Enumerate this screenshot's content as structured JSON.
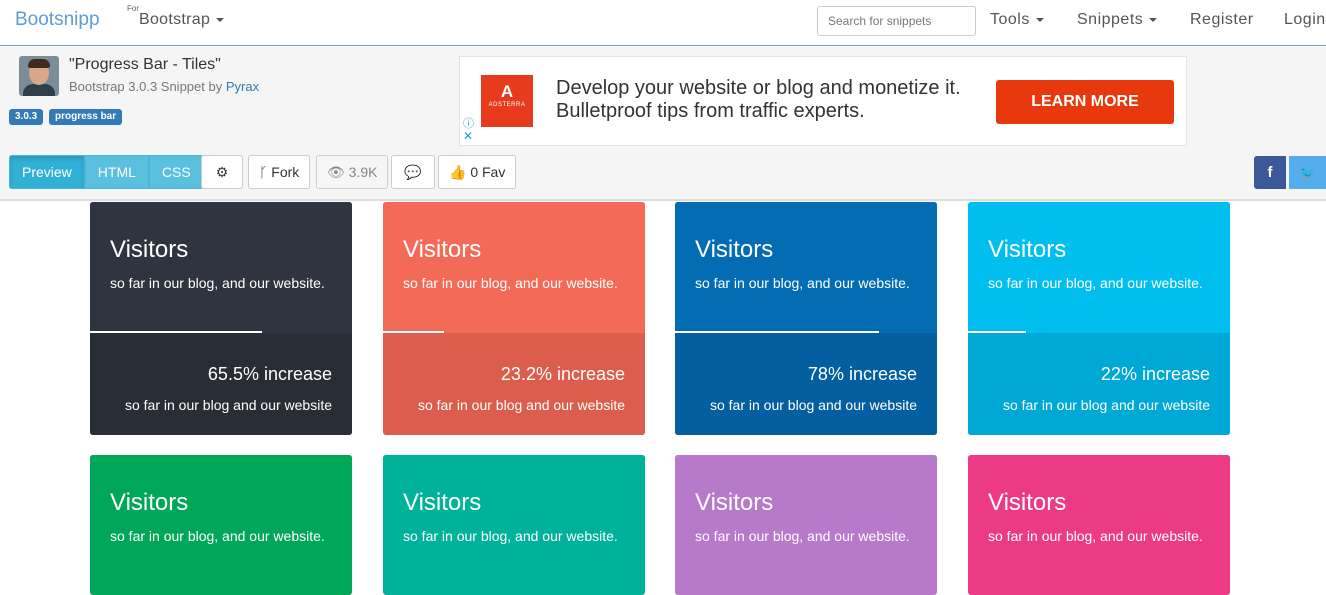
{
  "navbar": {
    "brand": "Bootsnipp",
    "for_label": "For",
    "framework": "Bootstrap",
    "search_placeholder": "Search for snippets",
    "tools": "Tools",
    "snippets": "Snippets",
    "register": "Register",
    "login": "Login"
  },
  "snippet": {
    "title": "\"Progress Bar - Tiles\"",
    "subtitle_prefix": "Bootstrap 3.0.3 Snippet by",
    "author": "Pyrax",
    "tags": [
      "3.0.3",
      "progress bar"
    ]
  },
  "ad": {
    "logo_letter": "A",
    "logo_brand": "ADSTERRA",
    "text": "Develop your website or blog and monetize it. Bulletproof tips from traffic experts.",
    "cta": "LEARN MORE",
    "info_icon": "ⓘ",
    "close_icon": "✕"
  },
  "toolbar": {
    "tabs": [
      "Preview",
      "HTML",
      "CSS"
    ],
    "active_tab": "Preview",
    "settings_icon": "gear-icon",
    "settings_glyph": "⚙",
    "fork_glyph": "ᚴ",
    "fork_label": "Fork",
    "views_glyph": "👁",
    "views_label": "3.9K",
    "comment_glyph": "💬",
    "fav_glyph": "👍",
    "fav_label": "0 Fav",
    "facebook_glyph": "f",
    "twitter_glyph": "🐦"
  },
  "tiles": [
    {
      "title": "Visitors",
      "subtitle": "so far in our blog, and our website.",
      "progress": 0.655,
      "percent": "65.5% increase",
      "footer": "so far in our blog and our website",
      "color_top": "#2f3440",
      "color_bottom": "#292d36"
    },
    {
      "title": "Visitors",
      "subtitle": "so far in our blog, and our website.",
      "progress": 0.232,
      "percent": "23.2% increase",
      "footer": "so far in our blog and our website",
      "color_top": "#f36a57",
      "color_bottom": "#db5e4d"
    },
    {
      "title": "Visitors",
      "subtitle": "so far in our blog, and our website.",
      "progress": 0.78,
      "percent": "78% increase",
      "footer": "so far in our blog and our website",
      "color_top": "#036cb3",
      "color_bottom": "#035f9f"
    },
    {
      "title": "Visitors",
      "subtitle": "so far in our blog, and our website.",
      "progress": 0.22,
      "percent": "22% increase",
      "footer": "so far in our blog and our website",
      "color_top": "#00bfef",
      "color_bottom": "#00a8d5"
    },
    {
      "title": "Visitors",
      "subtitle": "so far in our blog, and our website.",
      "color_top": "#00a758"
    },
    {
      "title": "Visitors",
      "subtitle": "so far in our blog, and our website.",
      "color_top": "#00b29a"
    },
    {
      "title": "Visitors",
      "subtitle": "so far in our blog, and our website.",
      "color_top": "#b779c9"
    },
    {
      "title": "Visitors",
      "subtitle": "so far in our blog, and our website.",
      "color_top": "#ec3a84"
    }
  ]
}
